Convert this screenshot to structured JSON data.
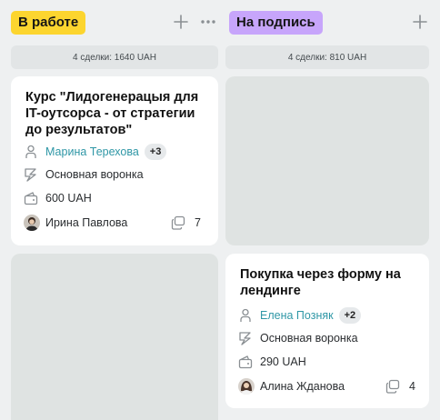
{
  "columns": [
    {
      "title": "В работе",
      "summary": "4 сделки: 1640 UAH",
      "cards": [
        {
          "title": "Курс \"Лидогенерацыя для IT-оутсорса - от стратегии до результатов\"",
          "contact": "Марина Терехова",
          "extra_contacts": "+3",
          "pipeline": "Основная воронка",
          "amount": "600 UAH",
          "owner": "Ирина Павлова",
          "comments": "7"
        }
      ]
    },
    {
      "title": "На подпись",
      "summary": "4 сделки: 810 UAH",
      "cards": [
        {
          "title": "Покупка через форму на лендинге",
          "contact": "Елена Позняк",
          "extra_contacts": "+2",
          "pipeline": "Основная воронка",
          "amount": "290 UAH",
          "owner": "Алина Жданова",
          "comments": "4"
        }
      ]
    }
  ],
  "colors": {
    "badge_in_progress": "#fcd52f",
    "badge_for_signing": "#c7a5fb",
    "link": "#2f97a6",
    "card": "#ffffff",
    "placeholder": "#dfe3e2",
    "background": "#eef0f1"
  },
  "icons": [
    "plus-icon",
    "more-icon",
    "user-icon",
    "funnel-icon",
    "wallet-icon",
    "comment-icon"
  ]
}
